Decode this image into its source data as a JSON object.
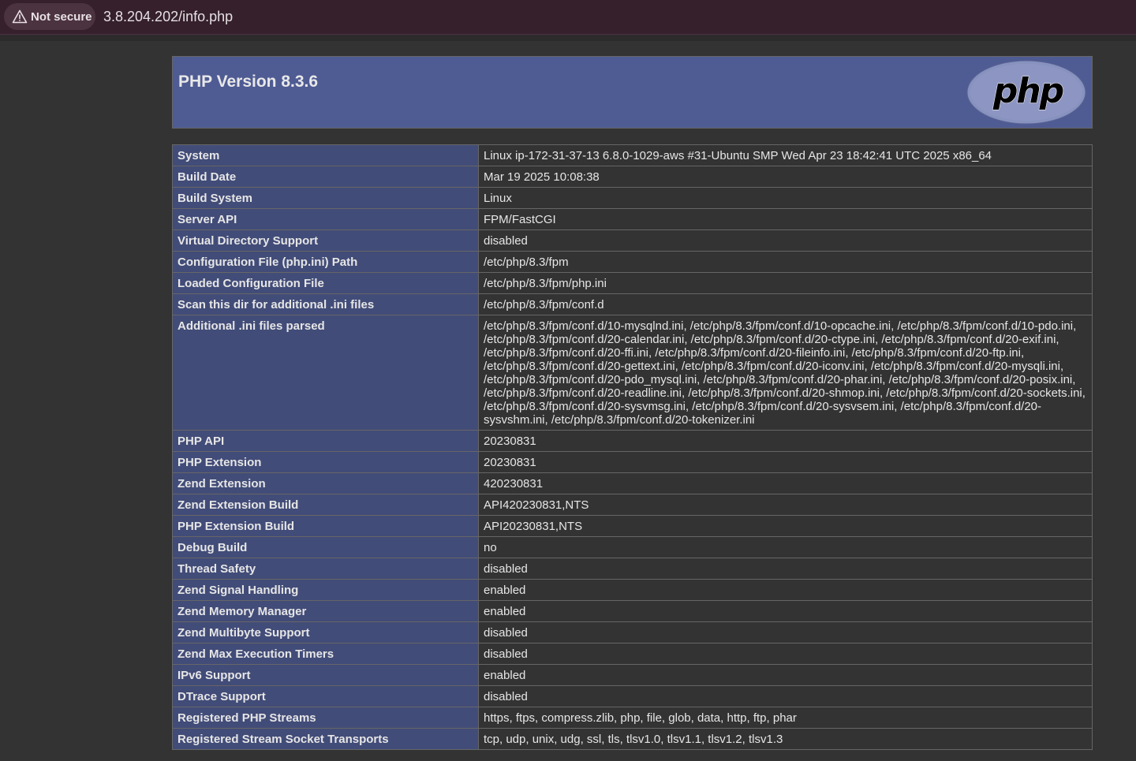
{
  "browser": {
    "security_label": "Not secure",
    "url": "3.8.204.202/info.php"
  },
  "header": {
    "title": "PHP Version 8.3.6",
    "logo_text": "php"
  },
  "rows": [
    {
      "key": "System",
      "value": "Linux ip-172-31-37-13 6.8.0-1029-aws #31-Ubuntu SMP Wed Apr 23 18:42:41 UTC 2025 x86_64"
    },
    {
      "key": "Build Date",
      "value": "Mar 19 2025 10:08:38"
    },
    {
      "key": "Build System",
      "value": "Linux"
    },
    {
      "key": "Server API",
      "value": "FPM/FastCGI"
    },
    {
      "key": "Virtual Directory Support",
      "value": "disabled"
    },
    {
      "key": "Configuration File (php.ini) Path",
      "value": "/etc/php/8.3/fpm"
    },
    {
      "key": "Loaded Configuration File",
      "value": "/etc/php/8.3/fpm/php.ini"
    },
    {
      "key": "Scan this dir for additional .ini files",
      "value": "/etc/php/8.3/fpm/conf.d"
    },
    {
      "key": "Additional .ini files parsed",
      "value": "/etc/php/8.3/fpm/conf.d/10-mysqlnd.ini, /etc/php/8.3/fpm/conf.d/10-opcache.ini, /etc/php/8.3/fpm/conf.d/10-pdo.ini, /etc/php/8.3/fpm/conf.d/20-calendar.ini, /etc/php/8.3/fpm/conf.d/20-ctype.ini, /etc/php/8.3/fpm/conf.d/20-exif.ini, /etc/php/8.3/fpm/conf.d/20-ffi.ini, /etc/php/8.3/fpm/conf.d/20-fileinfo.ini, /etc/php/8.3/fpm/conf.d/20-ftp.ini, /etc/php/8.3/fpm/conf.d/20-gettext.ini, /etc/php/8.3/fpm/conf.d/20-iconv.ini, /etc/php/8.3/fpm/conf.d/20-mysqli.ini, /etc/php/8.3/fpm/conf.d/20-pdo_mysql.ini, /etc/php/8.3/fpm/conf.d/20-phar.ini, /etc/php/8.3/fpm/conf.d/20-posix.ini, /etc/php/8.3/fpm/conf.d/20-readline.ini, /etc/php/8.3/fpm/conf.d/20-shmop.ini, /etc/php/8.3/fpm/conf.d/20-sockets.ini, /etc/php/8.3/fpm/conf.d/20-sysvmsg.ini, /etc/php/8.3/fpm/conf.d/20-sysvsem.ini, /etc/php/8.3/fpm/conf.d/20-sysvshm.ini, /etc/php/8.3/fpm/conf.d/20-tokenizer.ini"
    },
    {
      "key": "PHP API",
      "value": "20230831"
    },
    {
      "key": "PHP Extension",
      "value": "20230831"
    },
    {
      "key": "Zend Extension",
      "value": "420230831"
    },
    {
      "key": "Zend Extension Build",
      "value": "API420230831,NTS"
    },
    {
      "key": "PHP Extension Build",
      "value": "API20230831,NTS"
    },
    {
      "key": "Debug Build",
      "value": "no"
    },
    {
      "key": "Thread Safety",
      "value": "disabled"
    },
    {
      "key": "Zend Signal Handling",
      "value": "enabled"
    },
    {
      "key": "Zend Memory Manager",
      "value": "enabled"
    },
    {
      "key": "Zend Multibyte Support",
      "value": "disabled"
    },
    {
      "key": "Zend Max Execution Timers",
      "value": "disabled"
    },
    {
      "key": "IPv6 Support",
      "value": "enabled"
    },
    {
      "key": "DTrace Support",
      "value": "disabled"
    },
    {
      "key": "Registered PHP Streams",
      "value": "https, ftps, compress.zlib, php, file, glob, data, http, ftp, phar"
    },
    {
      "key": "Registered Stream Socket Transports",
      "value": "tcp, udp, unix, udg, ssl, tls, tlsv1.0, tlsv1.1, tlsv1.2, tlsv1.3"
    }
  ]
}
